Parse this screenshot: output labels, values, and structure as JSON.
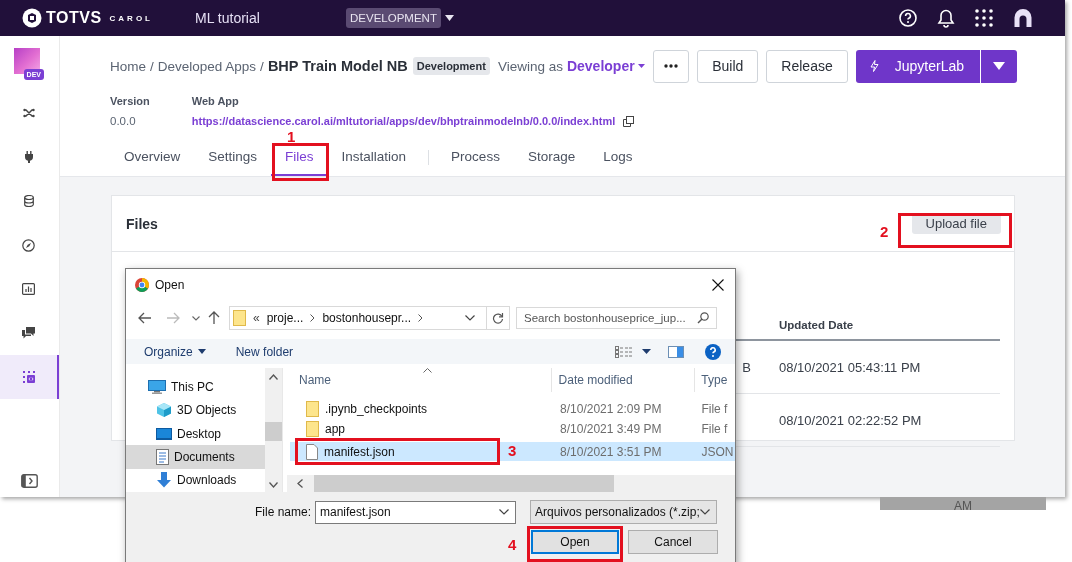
{
  "top_bar": {
    "logo_text": "TOTVS",
    "logo_subtext": "CAROL",
    "project": "ML tutorial",
    "environment": "DEVELOPMENT"
  },
  "sidebar": {
    "app_badge": "DEV",
    "items": [
      {
        "kind": "shuffle",
        "selected": false
      },
      {
        "kind": "plug",
        "selected": false
      },
      {
        "kind": "database",
        "selected": false
      },
      {
        "kind": "compass",
        "selected": false
      },
      {
        "kind": "chart",
        "selected": false
      },
      {
        "kind": "chat",
        "selected": false
      },
      {
        "kind": "app",
        "selected": true
      }
    ]
  },
  "breadcrumb": {
    "items": [
      "Home",
      "Developed Apps"
    ],
    "separator": "/",
    "current": "BHP Train Model NB",
    "status": "Development",
    "viewing_label": "Viewing as",
    "role": "Developer"
  },
  "actions": {
    "buttons": [
      "Build",
      "Release"
    ],
    "primary": "JupyterLab"
  },
  "meta": [
    {
      "label": "Version",
      "value": "0.0.0",
      "kind": "text"
    },
    {
      "label": "Web App",
      "value": "https://datascience.carol.ai/mltutorial/apps/dev/bhptrainmodelnb/0.0.0/index.html",
      "kind": "link"
    }
  ],
  "tab_groups": [
    [
      {
        "label": "Overview",
        "selected": false
      },
      {
        "label": "Settings",
        "selected": false
      },
      {
        "label": "Files",
        "selected": true
      },
      {
        "label": "Installation",
        "selected": false
      }
    ],
    [
      {
        "label": "Process",
        "selected": false
      },
      {
        "label": "Storage",
        "selected": false
      },
      {
        "label": "Logs",
        "selected": false
      }
    ]
  ],
  "files_card": {
    "title": "Files",
    "upload_button": "Upload file",
    "table": {
      "columns": [
        "Updated Date"
      ],
      "rows": [
        {
          "column_3": "B",
          "updated_date": "08/10/2021 05:43:11 PM"
        },
        {
          "updated_date": "08/10/2021 02:22:52 PM"
        }
      ]
    }
  },
  "background_fragment": "AM",
  "dialog": {
    "title": "Open",
    "address": {
      "overflow": "«",
      "segments": [
        "proje...",
        "bostonhousepr..."
      ]
    },
    "search": {
      "placeholder": "Search bostonhouseprice_jup..."
    },
    "toolbar": {
      "organize": "Organize",
      "new_folder": "New folder"
    },
    "tree": [
      {
        "label": "This PC",
        "kind": "pc",
        "selected": false,
        "children": [
          {
            "label": "3D Objects",
            "kind": "objects",
            "selected": false
          },
          {
            "label": "Desktop",
            "kind": "desktop",
            "selected": false
          },
          {
            "label": "Documents",
            "kind": "documents",
            "selected": true
          },
          {
            "label": "Downloads",
            "kind": "downloads",
            "selected": false
          }
        ]
      }
    ],
    "columns": [
      "Name",
      "Date modified",
      "Type"
    ],
    "files": [
      {
        "name": ".ipynb_checkpoints",
        "kind": "folder",
        "date": "8/10/2021 2:09 PM",
        "type": "File f",
        "selected": false
      },
      {
        "name": "app",
        "kind": "folder",
        "date": "8/10/2021 3:49 PM",
        "type": "File f",
        "selected": false
      },
      {
        "name": "manifest.json",
        "kind": "file",
        "date": "8/10/2021 3:51 PM",
        "type": "JSON",
        "selected": true
      }
    ],
    "file_name_label": "File name:",
    "file_name": "manifest.json",
    "filter": "Arquivos personalizados (*.zip;",
    "buttons": [
      {
        "label": "Open",
        "kind": "primary"
      },
      {
        "label": "Cancel",
        "kind": "secondary"
      }
    ]
  },
  "annotations": [
    {
      "number": "1"
    },
    {
      "number": "2"
    },
    {
      "number": "3"
    },
    {
      "number": "4"
    }
  ]
}
